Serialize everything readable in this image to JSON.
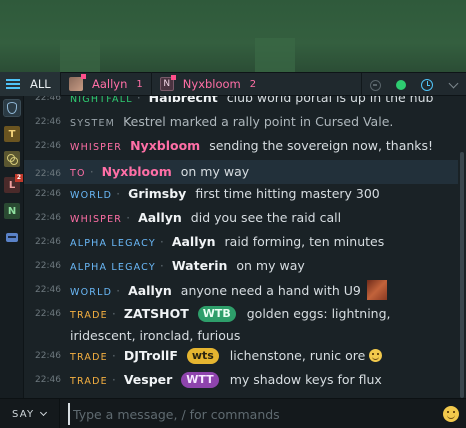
{
  "tabs": [
    {
      "label": "ALL"
    },
    {
      "name": "Aallyn",
      "count": "1"
    },
    {
      "name": "Nyxbloom",
      "count": "2",
      "initial": "N"
    }
  ],
  "sidebar": {
    "items": [
      {
        "icon": "shield-icon"
      },
      {
        "letter": "T"
      },
      {
        "icon": "rings-icon"
      },
      {
        "letter": "L",
        "badge": "2"
      },
      {
        "letter": "N"
      },
      {
        "icon": "robot-icon"
      }
    ]
  },
  "messages": [
    {
      "time": "22:46",
      "channel": "NIGHTFALL",
      "user": "Halbrecht",
      "text": "club world portal is up in the hub"
    },
    {
      "time": "22:46",
      "channel": "SYSTEM",
      "text": "Kestrel marked a rally point in Cursed Vale."
    },
    {
      "time": "22:46",
      "channel": "WHISPER",
      "user": "Nyxbloom",
      "text": "sending the sovereign now, thanks!"
    },
    {
      "time": "22:46",
      "channel": "TO",
      "user": "Nyxbloom",
      "text": "on my way"
    },
    {
      "time": "22:46",
      "channel": "WORLD",
      "user": "Grimsby",
      "text": "first time hitting mastery 300"
    },
    {
      "time": "22:46",
      "channel": "WHISPER",
      "user": "Aallyn",
      "text": "did you see the raid call"
    },
    {
      "time": "22:46",
      "channel": "ALPHA LEGACY",
      "user": "Aallyn",
      "text": "raid forming, ten minutes"
    },
    {
      "time": "22:46",
      "channel": "ALPHA LEGACY",
      "user": "Waterin",
      "text": "on my way"
    },
    {
      "time": "22:46",
      "channel": "WORLD",
      "user": "Aallyn",
      "text": "anyone need a hand with U9"
    },
    {
      "time": "22:46",
      "channel": "TRADE",
      "user": "ZATSHOT",
      "tag": "WTB",
      "text": "golden eggs: lightning, iridescent, ironclad, furious"
    },
    {
      "time": "22:46",
      "channel": "TRADE",
      "user": "DJTrollF",
      "tag": "wts",
      "text": "lichenstone, runic ore"
    },
    {
      "time": "22:46",
      "channel": "TRADE",
      "user": "Vesper",
      "tag": "WTT",
      "text": "my shadow keys for flux"
    }
  ],
  "input": {
    "mode": "SAY",
    "placeholder": "Type a message, / for commands"
  },
  "colors": {
    "accent": "#4fc3f7",
    "whisper": "#ff6fa6",
    "world": "#6ab8f7",
    "trade": "#f5b041",
    "online": "#2ecc71"
  }
}
